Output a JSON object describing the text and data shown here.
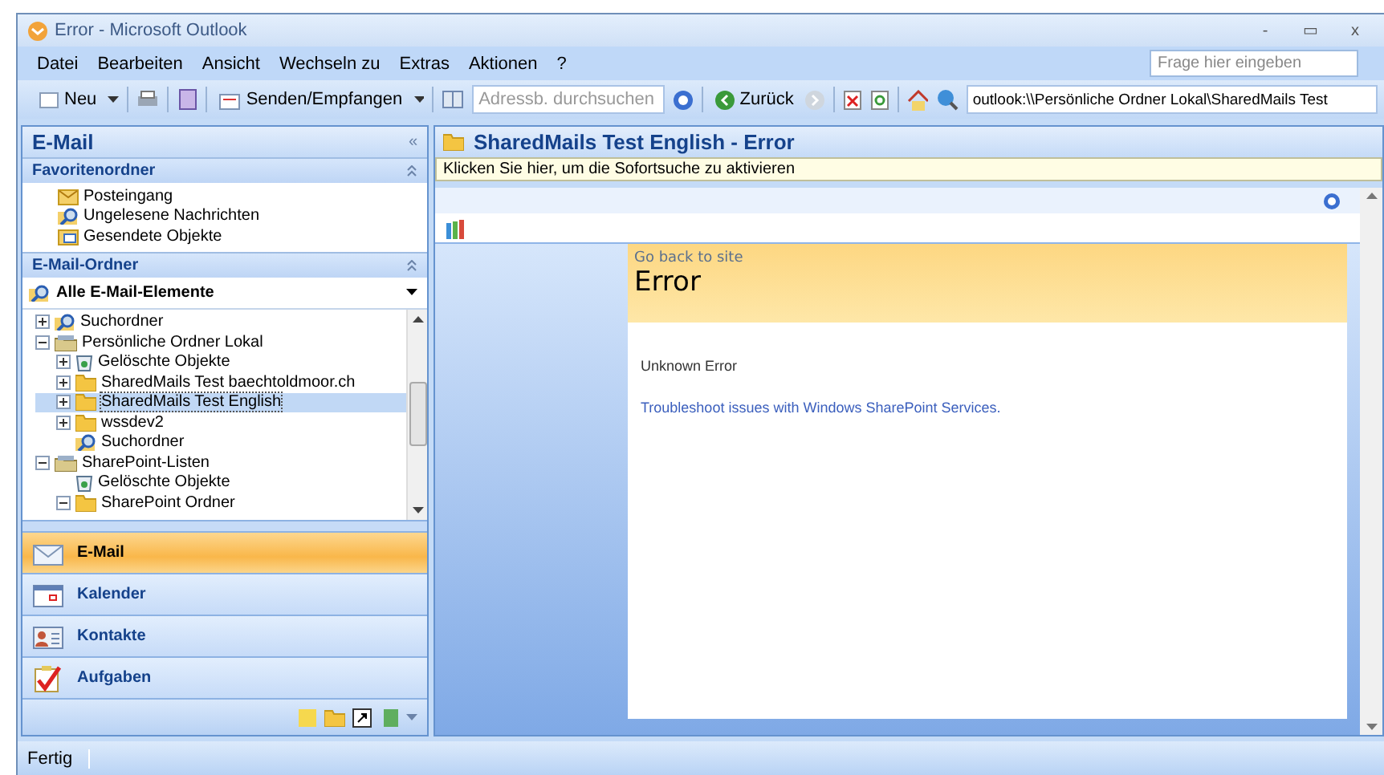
{
  "window": {
    "title": "Error - Microsoft Outlook",
    "controls": [
      "-",
      "▭",
      "x"
    ]
  },
  "menu": [
    "Datei",
    "Bearbeiten",
    "Ansicht",
    "Wechseln zu",
    "Extras",
    "Aktionen",
    "?"
  ],
  "help_field": {
    "placeholder": "Frage hier eingeben"
  },
  "toolbar": {
    "new_label": "Neu",
    "send_receive": "Senden/Empfangen",
    "address_search": {
      "placeholder": "Adressb. durchsuchen"
    },
    "back": "Zurück",
    "address": "outlook:\\\\Persönliche Ordner Lokal\\SharedMails Test"
  },
  "nav_pane": {
    "title": "E-Mail",
    "collapse": "«",
    "favorites": {
      "title": "Favoritenordner",
      "items": [
        {
          "label": "Posteingang",
          "kind": "inbox"
        },
        {
          "label": "Ungelesene Nachrichten",
          "kind": "search"
        },
        {
          "label": "Gesendete Objekte",
          "kind": "sent"
        }
      ]
    },
    "mail_folders": {
      "title": "E-Mail-Ordner",
      "view": "Alle E-Mail-Elemente",
      "tree": [
        {
          "label": "Suchordner",
          "kind": "search",
          "expanded": false,
          "selected": false
        },
        {
          "label": "Persönliche Ordner Lokal",
          "kind": "pst",
          "expanded": true,
          "selected": false,
          "children": [
            {
              "label": "Gelöschte Objekte",
              "kind": "trash",
              "expanded": false,
              "selected": false
            },
            {
              "label": "SharedMails Test baechtoldmoor.ch",
              "kind": "folder",
              "expanded": false,
              "selected": false
            },
            {
              "label": "SharedMails Test English",
              "kind": "folder",
              "expanded": false,
              "selected": true
            },
            {
              "label": "wssdev2",
              "kind": "folder",
              "expanded": false,
              "selected": false
            },
            {
              "label": "Suchordner",
              "kind": "search",
              "selected": false
            }
          ]
        },
        {
          "label": "SharePoint-Listen",
          "kind": "pst",
          "expanded": true,
          "selected": false,
          "children": [
            {
              "label": "Gelöschte Objekte",
              "kind": "trash",
              "selected": false
            },
            {
              "label": "SharePoint Ordner",
              "kind": "folder",
              "expanded": true,
              "selected": false
            }
          ]
        }
      ]
    },
    "buttons": [
      {
        "label": "E-Mail",
        "kind": "mail",
        "selected": true
      },
      {
        "label": "Kalender",
        "kind": "calendar",
        "selected": false
      },
      {
        "label": "Kontakte",
        "kind": "contacts",
        "selected": false
      },
      {
        "label": "Aufgaben",
        "kind": "tasks",
        "selected": false
      }
    ]
  },
  "content": {
    "title": "SharedMails Test English - Error",
    "instant_search": "Klicken Sie hier, um die Sofortsuche zu aktivieren",
    "page": {
      "back_link": "Go back to site",
      "heading": "Error",
      "message": "Unknown Error",
      "troubleshoot_link": "Troubleshoot issues with Windows SharePoint Services."
    }
  },
  "status_bar": {
    "text": "Fertig"
  }
}
